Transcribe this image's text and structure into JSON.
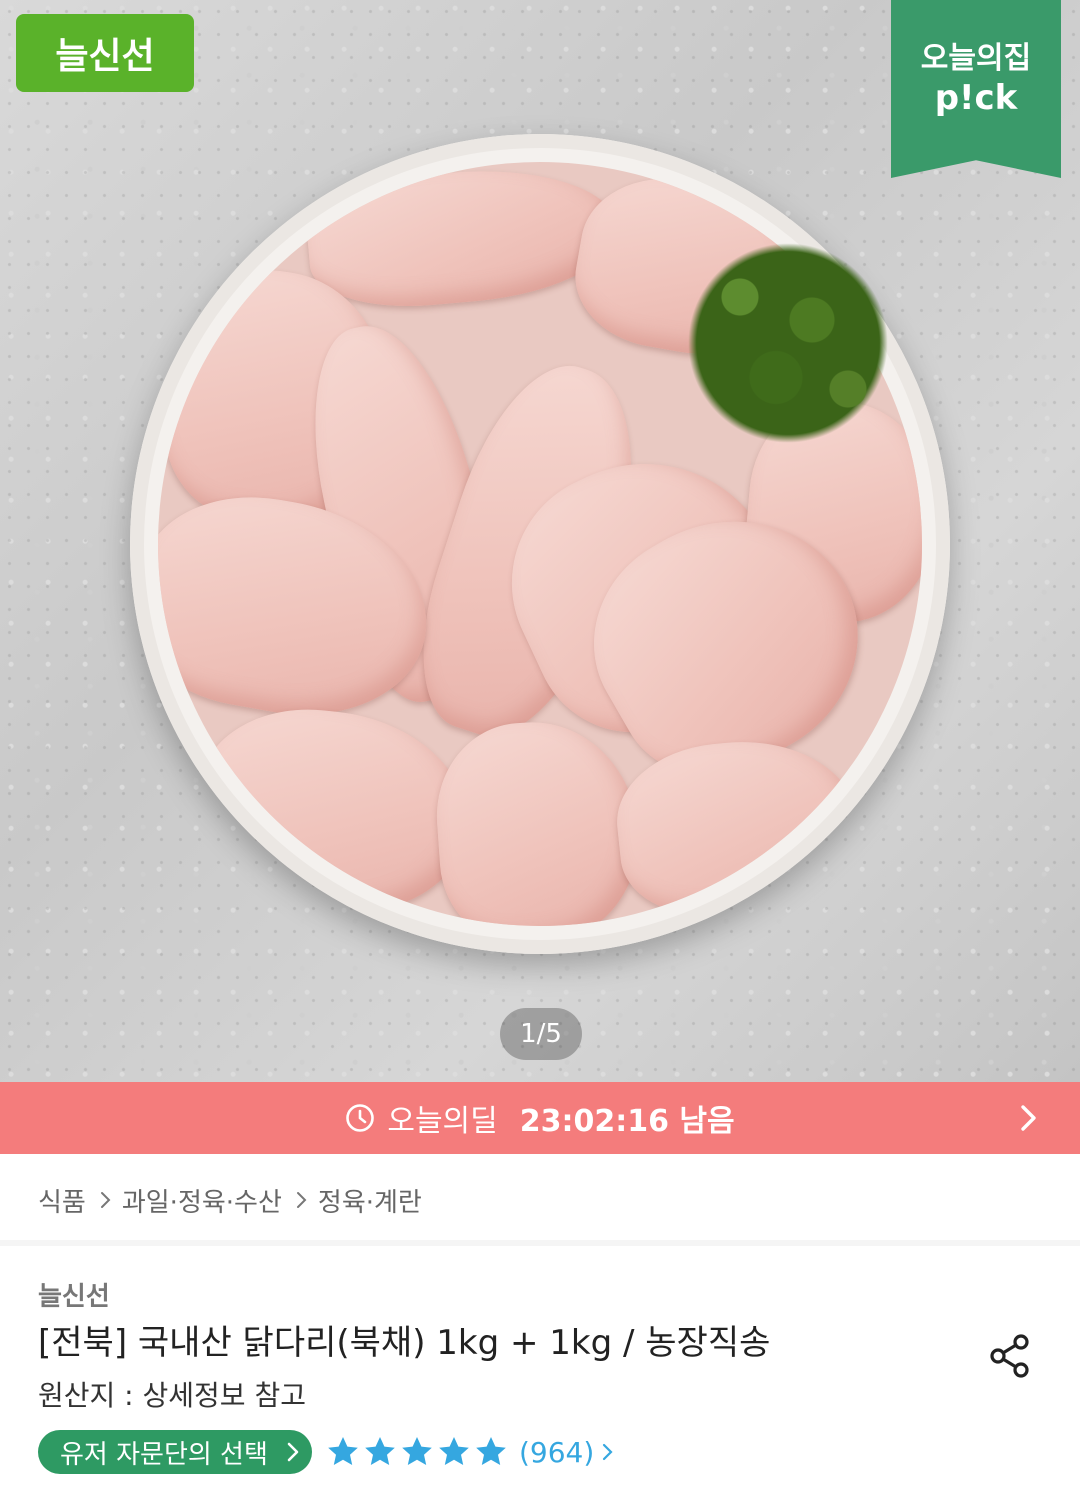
{
  "hero": {
    "brand_badge": "늘신선",
    "pick_badge_line1": "오늘의집",
    "pick_badge_line2": "p!ck",
    "pager": "1/5"
  },
  "deal": {
    "label": "오늘의딜",
    "time_remaining": "23:02:16 남음",
    "icon": "clock-icon",
    "color": "#f47c7c"
  },
  "breadcrumb": [
    "식품",
    "과일·정육·수산",
    "정육·계란"
  ],
  "product": {
    "seller": "늘신선",
    "title": "[전북] 국내산 닭다리(북채) 1kg + 1kg / 농장직송",
    "origin": "원산지 : 상세정보 참고",
    "advisor_label": "유저 자문단의 선택",
    "rating_stars": 5,
    "review_count": "(964)",
    "star_color": "#35a7e0",
    "advisor_color": "#2e9a63"
  }
}
